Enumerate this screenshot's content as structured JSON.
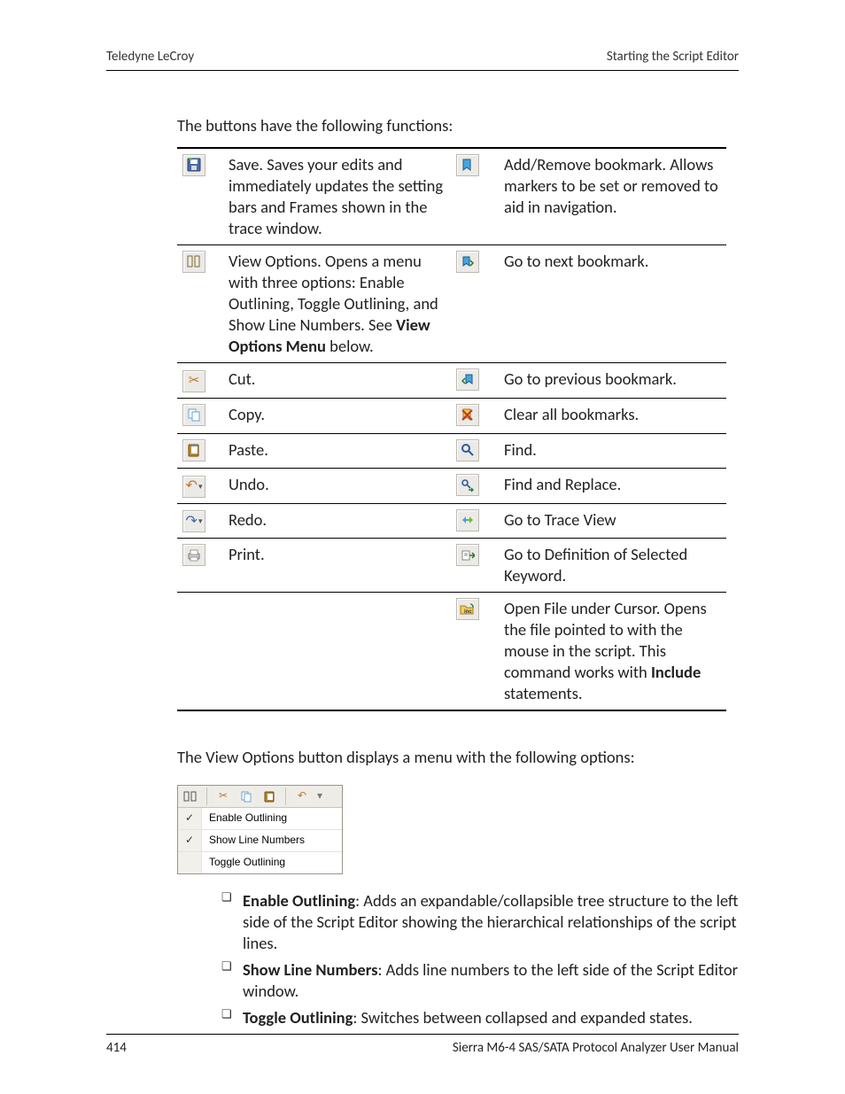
{
  "header": {
    "left": "Teledyne LeCroy",
    "right": "Starting the Script Editor"
  },
  "intro": "The buttons have the following functions:",
  "rows": [
    {
      "left_icon": "save-icon",
      "left": [
        {
          "t": "Save. Saves your edits and immediately updates the setting bars and Frames shown in the trace window."
        }
      ],
      "right_icon": "bookmark-add-icon",
      "right": [
        {
          "t": "Add/Remove bookmark. Allows markers to be set or removed to aid in navigation."
        }
      ]
    },
    {
      "left_icon": "view-options-icon",
      "left": [
        {
          "t": "View Options. Opens a menu with three options: Enable Outlining, Toggle Outlining, and Show Line Numbers. See "
        },
        {
          "t": "View Options Menu",
          "b": true
        },
        {
          "t": " below."
        }
      ],
      "right_icon": "bookmark-next-icon",
      "right": [
        {
          "t": "Go to next bookmark."
        }
      ]
    },
    {
      "left_icon": "cut-icon",
      "left": [
        {
          "t": "Cut."
        }
      ],
      "right_icon": "bookmark-prev-icon",
      "right": [
        {
          "t": "Go to previous bookmark."
        }
      ]
    },
    {
      "left_icon": "copy-icon",
      "left": [
        {
          "t": "Copy."
        }
      ],
      "right_icon": "bookmark-clear-icon",
      "right": [
        {
          "t": "Clear all bookmarks."
        }
      ]
    },
    {
      "left_icon": "paste-icon",
      "left": [
        {
          "t": "Paste."
        }
      ],
      "right_icon": "find-icon",
      "right": [
        {
          "t": "Find."
        }
      ]
    },
    {
      "left_icon": "undo-icon",
      "left": [
        {
          "t": "Undo."
        }
      ],
      "right_icon": "find-replace-icon",
      "right": [
        {
          "t": "Find and Replace."
        }
      ]
    },
    {
      "left_icon": "redo-icon",
      "left": [
        {
          "t": "Redo."
        }
      ],
      "right_icon": "goto-trace-icon",
      "right": [
        {
          "t": "Go to Trace View"
        }
      ]
    },
    {
      "left_icon": "print-icon",
      "left": [
        {
          "t": "Print."
        }
      ],
      "right_icon": "goto-definition-icon",
      "right": [
        {
          "t": "Go to Definition of Selected Keyword."
        }
      ]
    },
    {
      "left_icon": null,
      "left": [],
      "right_icon": "open-include-icon",
      "right": [
        {
          "t": "Open File under Cursor. Opens the file pointed to with the mouse in the script. This command works with "
        },
        {
          "t": "Include",
          "b": true
        },
        {
          "t": " statements."
        }
      ]
    }
  ],
  "view_intro": "The View Options button displays a menu with the following options:",
  "menu": {
    "items": [
      {
        "label": "Enable Outlining",
        "checked": true
      },
      {
        "label": "Show Line Numbers",
        "checked": true
      },
      {
        "label": "Toggle Outlining",
        "checked": false
      }
    ]
  },
  "options": [
    [
      {
        "t": "Enable Outlining",
        "b": true
      },
      {
        "t": ": Adds an expandable/collapsible tree structure to the left side of the Script Editor showing the hierarchical relationships of the script lines."
      }
    ],
    [
      {
        "t": "Show Line Numbers",
        "b": true
      },
      {
        "t": ": Adds line numbers to the left side of the Script Editor window."
      }
    ],
    [
      {
        "t": "Toggle Outlining",
        "b": true
      },
      {
        "t": ": Switches between collapsed and expanded states."
      }
    ]
  ],
  "footer": {
    "left": "414",
    "right": "Sierra M6-4 SAS/SATA Protocol Analyzer User Manual"
  }
}
